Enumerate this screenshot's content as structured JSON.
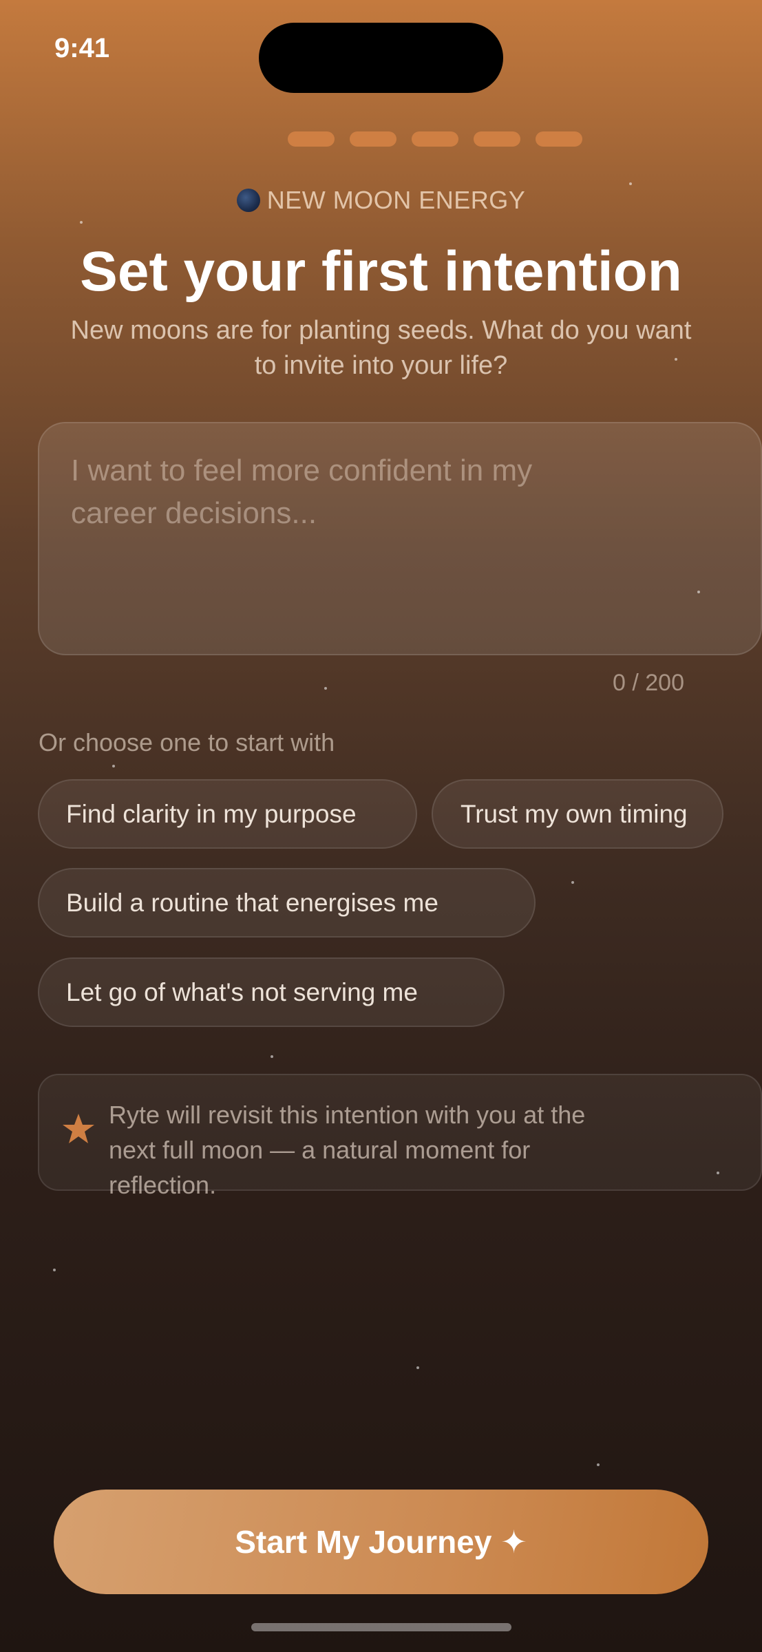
{
  "status_bar": {
    "time": "9:41"
  },
  "progress": {
    "steps_total": 5,
    "steps_filled": 5
  },
  "header": {
    "eyebrow": "NEW MOON ENERGY",
    "title": "Set your first intention",
    "subtitle": "New moons are for planting seeds. What do you want to invite into your life?"
  },
  "intention_input": {
    "value": "",
    "placeholder": "I want to feel more confident in my career decisions...",
    "counter": "0 / 200"
  },
  "suggestions": {
    "label": "Or choose one to start with",
    "items": [
      "Find clarity in my purpose",
      "Trust my own timing",
      "Build a routine that energises me",
      "Let go of what's not serving me"
    ]
  },
  "note": {
    "icon": "star-icon",
    "text": "Ryte will revisit this intention with you at the next full moon — a natural moment for reflection."
  },
  "cta": {
    "label": "Start My Journey ✦"
  },
  "colors": {
    "accent": "#cf7f43",
    "background_top": "#c47a3e",
    "background_bottom": "#1f1511"
  }
}
